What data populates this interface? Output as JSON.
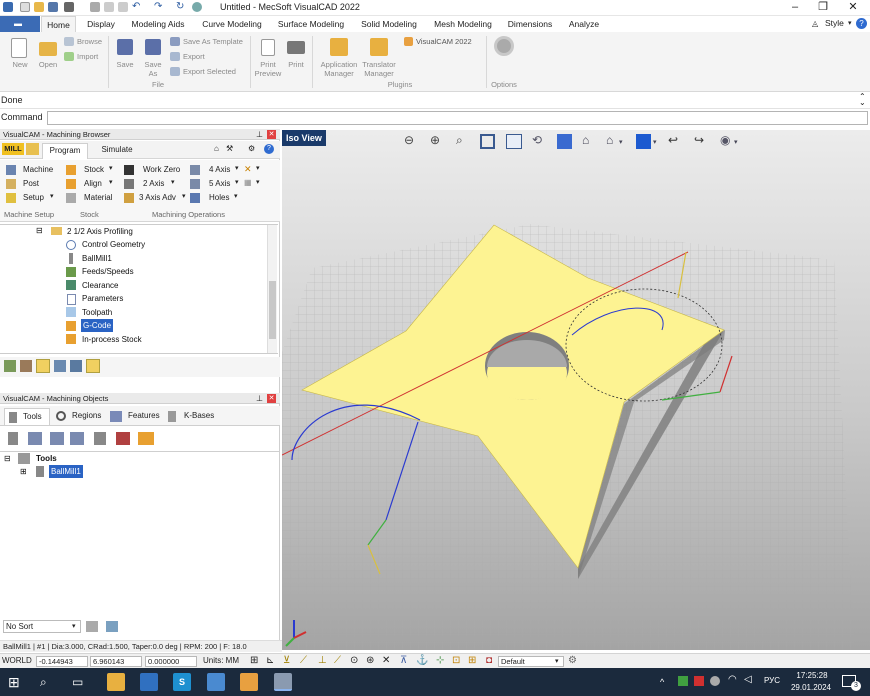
{
  "title": {
    "text": "Untitled - MecSoft VisualCAD 2022"
  },
  "ribbon_tabs": [
    "Home",
    "Display",
    "Modeling Aids",
    "Curve Modeling",
    "Surface Modeling",
    "Solid Modeling",
    "Mesh Modeling",
    "Dimensions",
    "Analyze"
  ],
  "style_label": "Style",
  "ribbon": {
    "new": "New",
    "open": "Open",
    "browse": "Browse",
    "import": "Import",
    "save": "Save",
    "save_as": "Save As",
    "save_as_template": "Save As Template",
    "export": "Export",
    "export_selected": "Export Selected",
    "print_preview": "Print Preview",
    "print": "Print",
    "app_manager": "Application Manager",
    "translator_manager": "Translator Manager",
    "visualcam": "VisualCAM 2022",
    "file_group": "File",
    "plugins_group": "Plugins",
    "options_group": "Options"
  },
  "status_text": "Done",
  "command_label": "Command",
  "browser": {
    "title": "VisualCAM - Machining Browser",
    "mill": "MILL",
    "tab_program": "Program",
    "tab_simulate": "Simulate",
    "machine": "Machine",
    "post": "Post",
    "setup": "Setup",
    "stock": "Stock",
    "align": "Align",
    "material": "Material",
    "work_zero": "Work Zero",
    "two_axis": "2 Axis",
    "three_axis_adv": "3 Axis Adv",
    "four_axis": "4 Axis",
    "five_axis": "5 Axis",
    "holes": "Holes",
    "grp_machine_setup": "Machine Setup",
    "grp_stock": "Stock",
    "grp_machining_ops": "Machining Operations",
    "tree": [
      {
        "label": "2 1/2 Axis Profiling"
      },
      {
        "label": "Control Geometry"
      },
      {
        "label": "BallMill1"
      },
      {
        "label": "Feeds/Speeds"
      },
      {
        "label": "Clearance"
      },
      {
        "label": "Parameters"
      },
      {
        "label": "Toolpath"
      },
      {
        "label": "G-Code"
      },
      {
        "label": "In-process Stock"
      }
    ]
  },
  "objects": {
    "title": "VisualCAM - Machining Objects",
    "tab_tools": "Tools",
    "tab_regions": "Regions",
    "tab_features": "Features",
    "tab_kbases": "K-Bases",
    "root": "Tools",
    "child": "BallMill1",
    "sort": "No Sort"
  },
  "viewport": {
    "label": "Iso View"
  },
  "statusbar": "BallMill1 | #1 | Dia:3.000, CRad:1.500, Taper:0.0 deg | RPM: 200 | F: 18.0",
  "coords": {
    "mode": "WORLD",
    "x": "-0.144943",
    "y": "6.960143",
    "z": "0.000000",
    "units": "Units: MM",
    "layer": "Default"
  },
  "taskbar": {
    "lang": "РУС",
    "time": "17:25:28",
    "date": "29.01.2024",
    "notif": "3"
  }
}
